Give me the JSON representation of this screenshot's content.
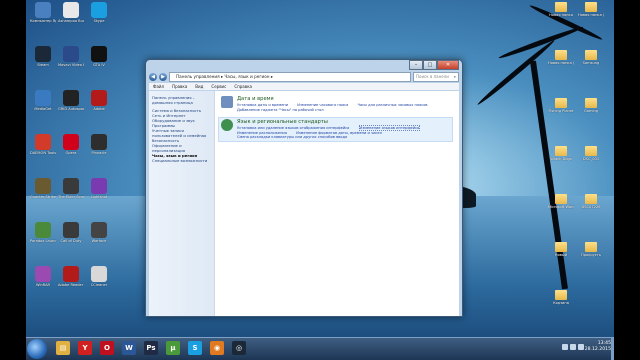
{
  "desktop_left_icons": [
    {
      "label": "Компьютер Ярлык",
      "color": "#4a7fc0"
    },
    {
      "label": "Ashampoo Burning",
      "color": "#e8e8e8"
    },
    {
      "label": "Skype",
      "color": "#1aa0e0"
    },
    {
      "label": "Steam",
      "color": "#1b2838"
    },
    {
      "label": "Movavi Video Editor 11",
      "color": "#2a4a8a"
    },
    {
      "label": "GTA IV",
      "color": "#111"
    },
    {
      "label": "MediaGet",
      "color": "#3a7ac0"
    },
    {
      "label": "GRID Autosport",
      "color": "#222"
    },
    {
      "label": "Adobe",
      "color": "#b31b1b"
    },
    {
      "label": "DAEMON Tools Lite",
      "color": "#d23a2a"
    },
    {
      "label": "Opera",
      "color": "#d0021b"
    },
    {
      "label": "Pinnacle",
      "color": "#2e2e2e"
    },
    {
      "label": "Counter-Strike",
      "color": "#6a5a30"
    },
    {
      "label": "The Elder Scrolls",
      "color": "#3a3a3a"
    },
    {
      "label": "Lightshot",
      "color": "#7a3ab0"
    },
    {
      "label": "Paradox Launcher",
      "color": "#4a8a3a"
    },
    {
      "label": "Call of Duty",
      "color": "#3a3a3a"
    },
    {
      "label": "Warface",
      "color": "#444"
    },
    {
      "label": "WinRAR",
      "color": "#9a4ab0"
    },
    {
      "label": "Adobe Reader DC",
      "color": "#b31b1b"
    },
    {
      "label": "CCleaner",
      "color": "#d8d8d8"
    }
  ],
  "desktop_right_icons": [
    {
      "label": "Новая папка"
    },
    {
      "label": "Новая папка (2)"
    },
    {
      "label": "Новая папка (3)"
    },
    {
      "label": "Samsung"
    },
    {
      "label": "Fishing Planet"
    },
    {
      "label": "Gaming"
    },
    {
      "label": "Watch Dogs"
    },
    {
      "label": "DSC_001"
    },
    {
      "label": "Microsoft Word"
    },
    {
      "label": "DSC07226"
    },
    {
      "label": "Новый"
    },
    {
      "label": "Прокрусть"
    },
    {
      "label": "Корзина"
    }
  ],
  "window": {
    "address": "Панель управления ▸ Часы, язык и регион ▸",
    "search_placeholder": "Поиск в панели управления",
    "menu": [
      "Файл",
      "Правка",
      "Вид",
      "Сервис",
      "Справка"
    ],
    "left_pane": [
      {
        "text": "Панель управления – домашняя страница",
        "current": false
      },
      {
        "text": "Система и безопасность",
        "current": false
      },
      {
        "text": "Сеть и Интернет",
        "current": false
      },
      {
        "text": "Оборудование и звук",
        "current": false
      },
      {
        "text": "Программы",
        "current": false
      },
      {
        "text": "Учетные записи пользователей и семейная безопасность",
        "current": false
      },
      {
        "text": "Оформление и персонализация",
        "current": false
      },
      {
        "text": "Часы, язык и регион",
        "current": true
      },
      {
        "text": "Специальные возможности",
        "current": false
      }
    ],
    "categories": [
      {
        "title": "Дата и время",
        "icon_color": "#6f8fbf",
        "links": [
          "Установка даты и времени",
          "Изменение часового пояса",
          "Часы для различных часовых поясов",
          "Добавление гаджета \"Часы\" на рабочий стол"
        ]
      },
      {
        "title": "Язык и региональные стандарты",
        "icon_color": "#3f8f4f",
        "links": [
          "Установка или удаление языков отображения интерфейса",
          "Изменение языков интерфейса",
          "Изменение расположения",
          "Изменение форматов даты, времени и чисел",
          "Смена раскладки клавиатуры или других способов ввода"
        ]
      }
    ]
  },
  "taskbar": {
    "time": "13:45",
    "date": "28.12.2015",
    "items": [
      {
        "name": "explorer",
        "color": "#e0b040",
        "glyph": "▤"
      },
      {
        "name": "yandex",
        "color": "#d02020",
        "glyph": "Y"
      },
      {
        "name": "opera",
        "color": "#c01020",
        "glyph": "O"
      },
      {
        "name": "word",
        "color": "#2b5797",
        "glyph": "W"
      },
      {
        "name": "photoshop",
        "color": "#1f2a44",
        "glyph": "Ps"
      },
      {
        "name": "utorrent",
        "color": "#4a9a3a",
        "glyph": "µ"
      },
      {
        "name": "skype",
        "color": "#1aa0e0",
        "glyph": "S"
      },
      {
        "name": "media",
        "color": "#e07a20",
        "glyph": "◉"
      },
      {
        "name": "steam",
        "color": "#1b2838",
        "glyph": "◎"
      }
    ]
  }
}
